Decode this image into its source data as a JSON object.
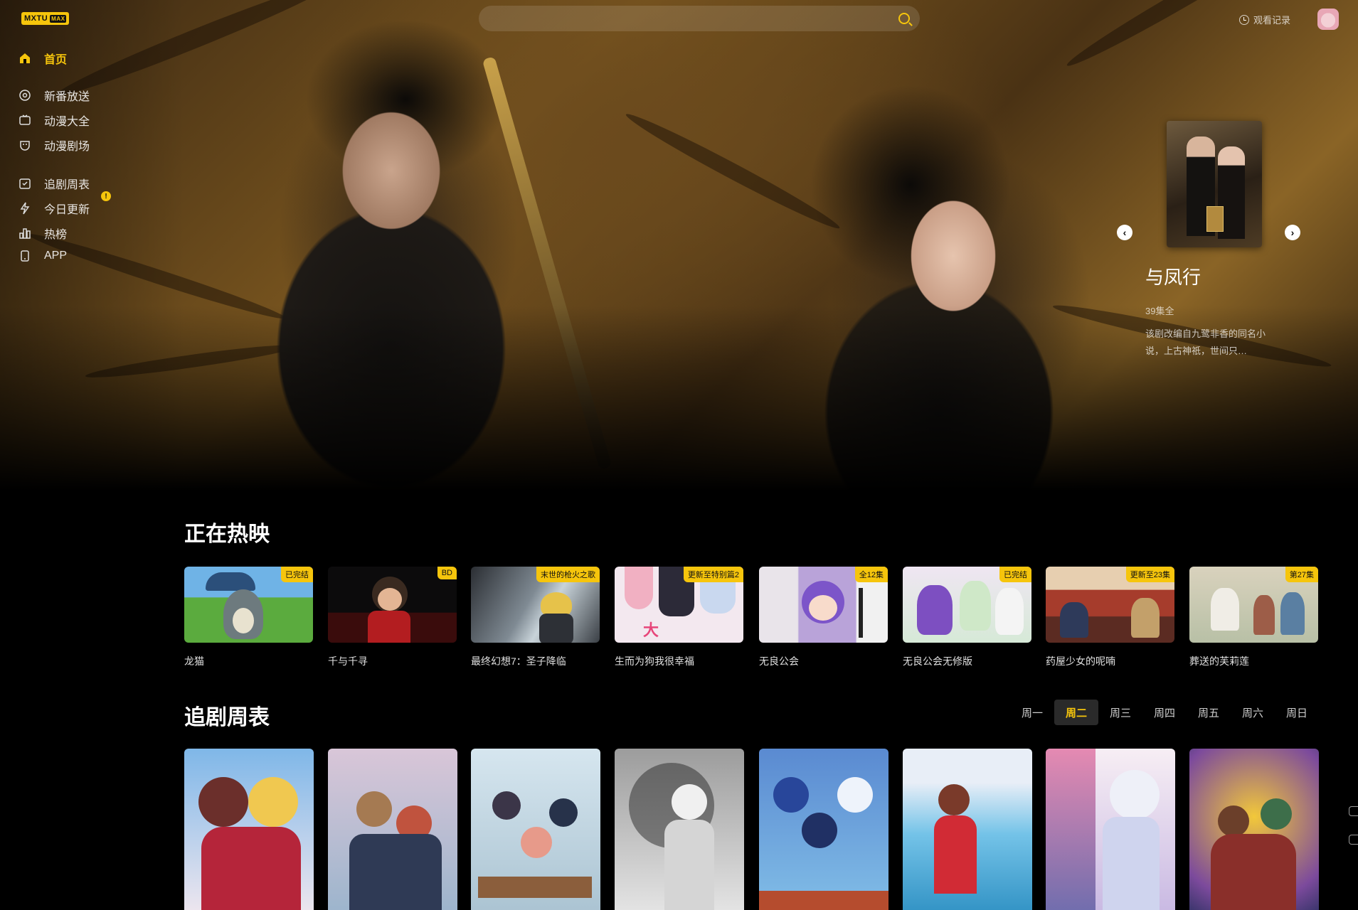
{
  "header": {
    "logo_text": "MXTU",
    "logo_badge": "MAX",
    "search_placeholder": "",
    "history_label": "观看记录"
  },
  "sidebar": {
    "items": [
      {
        "label": "首页",
        "icon": "home-icon",
        "active": true
      },
      {
        "label": "新番放送",
        "icon": "broadcast-icon"
      },
      {
        "label": "动漫大全",
        "icon": "tv-icon"
      },
      {
        "label": "动漫剧场",
        "icon": "theater-icon"
      },
      {
        "label": "追剧周表",
        "icon": "calendar-icon"
      },
      {
        "label": "今日更新",
        "icon": "lightning-icon",
        "badge": "!"
      },
      {
        "label": "热榜",
        "icon": "ranking-icon"
      },
      {
        "label": "APP",
        "icon": "phone-icon"
      }
    ]
  },
  "hero": {
    "title": "与凤行",
    "episodes": "39集全",
    "description": "该剧改编自九鹭非香的同名小说，上古神祇，世间只…",
    "prev_icon": "chevron-left-icon",
    "next_icon": "chevron-right-icon"
  },
  "now_showing": {
    "title": "正在热映",
    "items": [
      {
        "name": "龙猫",
        "badge": "已完结"
      },
      {
        "name": "千与千寻",
        "badge": "BD"
      },
      {
        "name": "最终幻想7：圣子降临",
        "badge": "末世的枪火之歌"
      },
      {
        "name": "生而为狗我很幸福",
        "badge": "更新至特别篇2"
      },
      {
        "name": "无良公会",
        "badge": "全12集"
      },
      {
        "name": "无良公会无修版",
        "badge": "已完结"
      },
      {
        "name": "药屋少女的呢喃",
        "badge": "更新至23集"
      },
      {
        "name": "葬送的芙莉莲",
        "badge": "第27集"
      }
    ]
  },
  "weekly": {
    "title": "追剧周表",
    "days": [
      "周一",
      "周二",
      "周三",
      "周四",
      "周五",
      "周六",
      "周日"
    ],
    "active_day": "周二"
  },
  "colors": {
    "accent": "#f6c50c",
    "background": "#000000"
  }
}
